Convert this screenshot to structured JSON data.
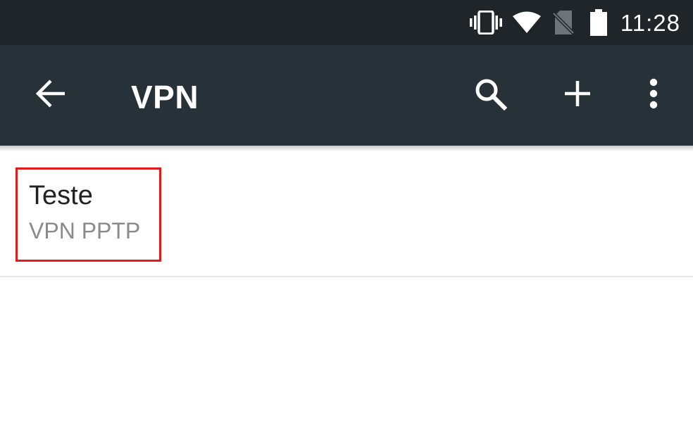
{
  "status_bar": {
    "time": "11:28",
    "icons": [
      "vibrate-icon",
      "wifi-icon",
      "no-sim-icon",
      "battery-icon"
    ]
  },
  "toolbar": {
    "title": "VPN",
    "back_icon": "back-arrow-icon",
    "actions": [
      "search-icon",
      "add-icon",
      "more-vert-icon"
    ]
  },
  "vpn_list": {
    "items": [
      {
        "name": "Teste",
        "type": "VPN PPTP"
      }
    ]
  },
  "colors": {
    "status_bar": "#1f2529",
    "toolbar": "#263238",
    "highlight": "#e21a1a"
  }
}
